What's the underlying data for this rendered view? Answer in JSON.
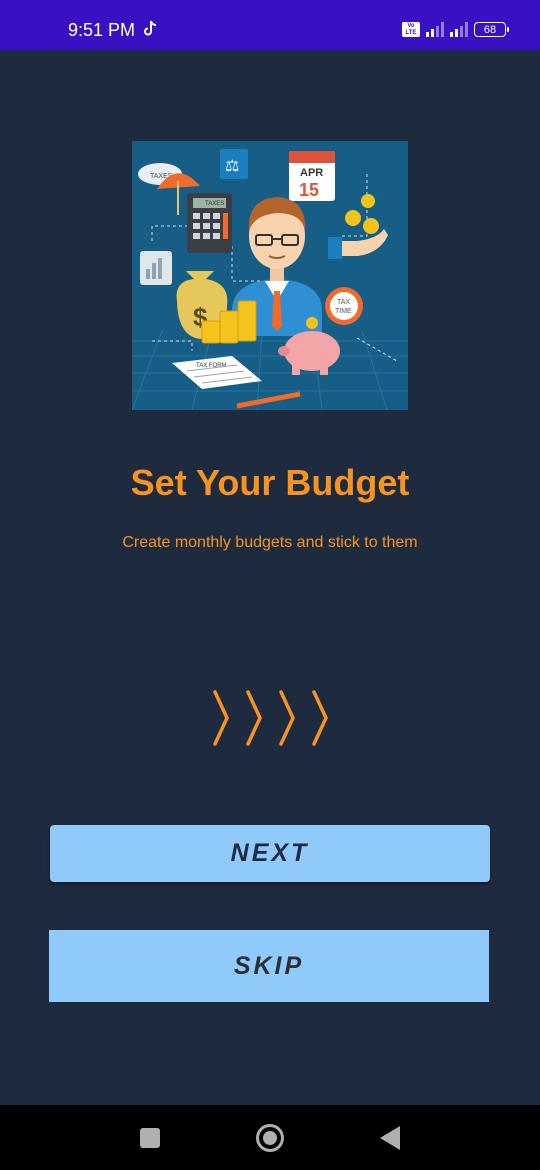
{
  "status_bar": {
    "time": "9:51 PM",
    "volte_label": "Vo LTE",
    "battery": "68",
    "icons": [
      "tiktok-icon",
      "volte-icon",
      "signal-icon",
      "signal-icon",
      "battery-icon"
    ]
  },
  "onboarding": {
    "title": "Set Your Budget",
    "subtitle": "Create monthly budgets and stick to them",
    "illustration": {
      "umbrella_text": "TAXES",
      "calculator_text": "TAXES",
      "calendar_month": "APR",
      "calendar_day": "15",
      "clock_text_1": "TAX",
      "clock_text_2": "TIME",
      "form_text": "TAX FORM"
    }
  },
  "buttons": {
    "next": "NEXT",
    "skip": "SKIP"
  },
  "colors": {
    "background": "#1e2a3e",
    "accent": "#f7931e",
    "button": "#90caf9",
    "status_bar": "#3a11c2"
  },
  "nav_bar": {
    "icons": [
      "recents-icon",
      "home-icon",
      "back-icon"
    ]
  }
}
